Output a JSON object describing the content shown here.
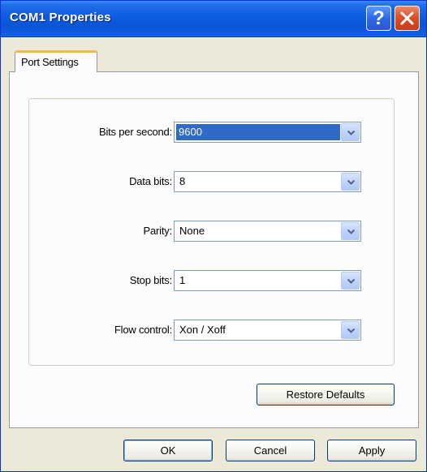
{
  "window": {
    "title": "COM1 Properties",
    "help_glyph": "?",
    "accent_color": "#0a55d8"
  },
  "tabs": [
    {
      "label": "Port Settings",
      "selected": true
    }
  ],
  "fields": [
    {
      "label": "Bits per second:",
      "value": "9600",
      "focused": true
    },
    {
      "label": "Data bits:",
      "value": "8",
      "focused": false
    },
    {
      "label": "Parity:",
      "value": "None",
      "focused": false
    },
    {
      "label": "Stop bits:",
      "value": "1",
      "focused": false
    },
    {
      "label": "Flow control:",
      "value": "Xon / Xoff",
      "focused": false
    }
  ],
  "buttons": {
    "restore_defaults": "Restore Defaults",
    "ok": "OK",
    "cancel": "Cancel",
    "apply": "Apply"
  },
  "icons": {
    "help": "help-icon",
    "close": "close-icon",
    "dropdown": "chevron-down-icon"
  }
}
